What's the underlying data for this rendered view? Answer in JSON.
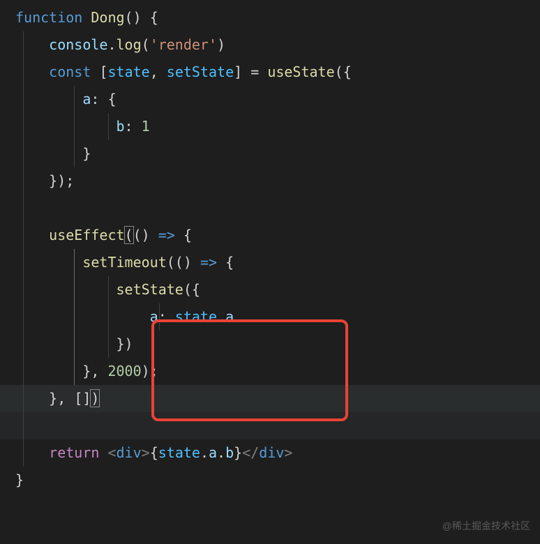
{
  "watermark": "@稀土掘金技术社区",
  "tokens": {
    "function": "function",
    "Dong": "Dong",
    "lparen": "(",
    "rparen": ")",
    "lbrace": "{",
    "rbrace": "}",
    "console": "console",
    "dot": ".",
    "log": "log",
    "render_str": "'render'",
    "const": "const",
    "lbracket": "[",
    "rbracket": "]",
    "state": "state",
    "comma": ",",
    "setState": "setState",
    "equals": "=",
    "useState": "useState",
    "a": "a",
    "b": "b",
    "colon": ":",
    "one": "1",
    "semi": ";",
    "useEffect": "useEffect",
    "arrow": "=>",
    "setTimeout": "setTimeout",
    "two_thousand": "2000",
    "return": "return",
    "ltag": "<",
    "gtag": ">",
    "div": "div",
    "ltagclose": "</"
  }
}
